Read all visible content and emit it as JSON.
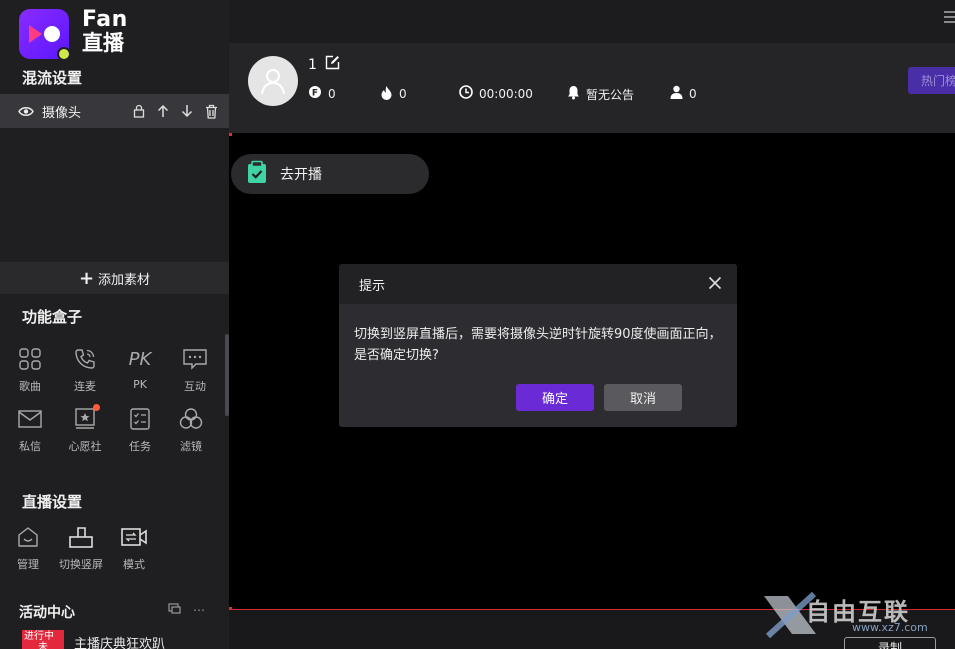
{
  "brand": {
    "en": "Fan",
    "cn": "直播"
  },
  "mix": {
    "title": "混流设置",
    "layer_name": "摄像头",
    "add_label": "添加素材"
  },
  "toolbox": {
    "title": "功能盒子",
    "items": [
      {
        "label": "歌曲",
        "icon": "music-grid-icon"
      },
      {
        "label": "连麦",
        "icon": "phone-icon"
      },
      {
        "label": "PK",
        "icon": "pk-icon"
      },
      {
        "label": "互动",
        "icon": "chat-icon"
      },
      {
        "label": "私信",
        "icon": "mail-icon"
      },
      {
        "label": "心愿社",
        "icon": "wish-icon"
      },
      {
        "label": "任务",
        "icon": "task-icon"
      },
      {
        "label": "滤镜",
        "icon": "filter-icon"
      }
    ]
  },
  "live_settings": {
    "title": "直播设置",
    "items": [
      {
        "label": "管理",
        "icon": "home-icon"
      },
      {
        "label": "切换竖屏",
        "icon": "rotate-icon"
      },
      {
        "label": "模式",
        "icon": "camera-switch-icon"
      }
    ]
  },
  "activity": {
    "title": "活动中心",
    "tag": "进行中",
    "tag_sub": "未",
    "text": "主播庆典狂欢趴"
  },
  "topbar": {
    "username": "1",
    "coins": "0",
    "heat": "0",
    "timer": "00:00:00",
    "announcement": "暂无公告",
    "viewers": "0",
    "hot_label": "热门榜"
  },
  "preview": {
    "go_live": "去开播",
    "record": "录制"
  },
  "dialog": {
    "title": "提示",
    "message": "切换到竖屏直播后，需要将摄像头逆时针旋转90度使画面正向，是否确定切换?",
    "ok": "确定",
    "cancel": "取消"
  },
  "watermark": {
    "text": "自由互联",
    "url": "www.xz7.com"
  },
  "colors": {
    "accent": "#6a2bd6",
    "hot_button": "#4a2ea8",
    "live_tag": "#e3283e"
  }
}
